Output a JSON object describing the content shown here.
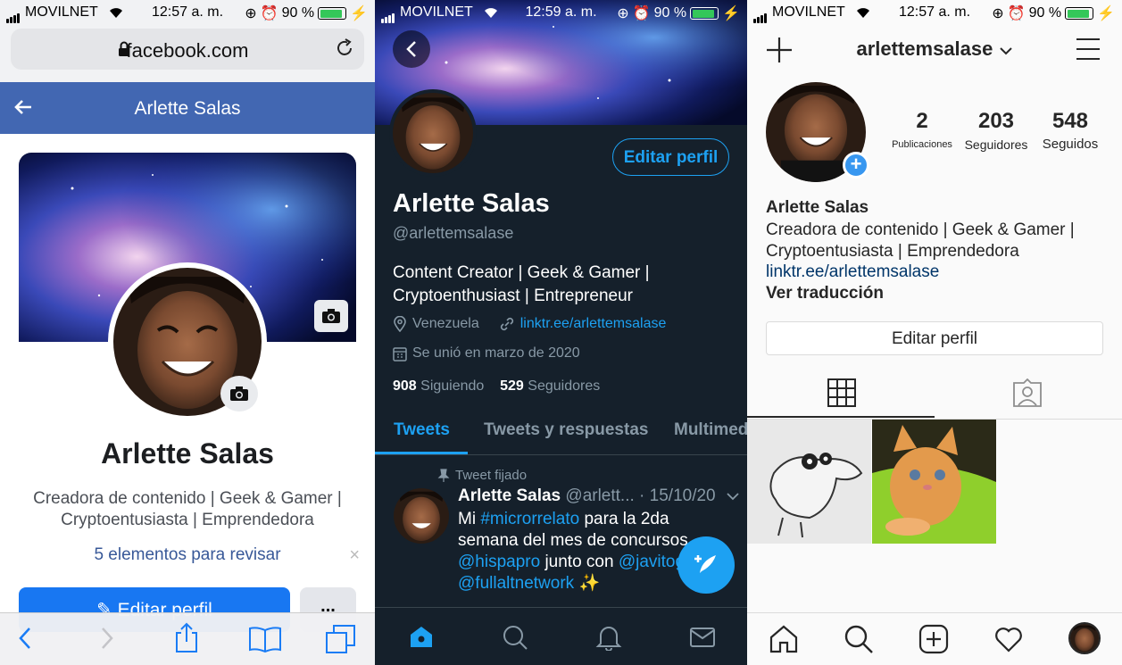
{
  "facebook": {
    "status": {
      "carrier": "MOVILNET",
      "time": "12:57 a. m.",
      "battery": "90 %",
      "battery_level": 0.9
    },
    "url": "facebook.com",
    "header_title": "Arlette Salas",
    "name": "Arlette Salas",
    "bio": "Creadora de contenido | Geek & Gamer | Cryptoentusiasta | Emprendedora",
    "review_link": "5 elementos para revisar",
    "close_glyph": "×",
    "edit_button": "Editar perfil",
    "more_button": "...",
    "icons": [
      "back-arrow-icon",
      "lock-icon",
      "reload-icon",
      "camera-icon",
      "nav-back-icon",
      "nav-forward-icon",
      "share-icon",
      "bookmarks-icon",
      "tabs-icon"
    ],
    "colors": {
      "brand": "#4267b2",
      "button": "#1877f2",
      "link": "#385898"
    }
  },
  "twitter": {
    "status": {
      "carrier": "MOVILNET",
      "time": "12:59 a. m.",
      "battery": "90 %",
      "battery_level": 0.9
    },
    "edit_button": "Editar perfil",
    "name": "Arlette Salas",
    "handle": "@arlettemsalase",
    "bio": "Content Creator | Geek & Gamer | Cryptoenthusiast | Entrepreneur",
    "location": "Venezuela",
    "link": "linktr.ee/arlettemsalase",
    "joined": "Se unió en marzo de 2020",
    "following_count": "908",
    "following_label": "Siguiendo",
    "followers_count": "529",
    "followers_label": "Seguidores",
    "tabs": [
      "Tweets",
      "Tweets y respuestas",
      "Multimed"
    ],
    "pinned_label": "Tweet fijado",
    "tweet": {
      "author": "Arlette Salas",
      "meta": "@arlett... · 15/10/20",
      "text_prefix": "Mi ",
      "hashtag": "#microrrelato",
      "text_mid": " para la 2da semana del mes de concursos ",
      "mention1": "@hispapro",
      "text_join": " junto con ",
      "mention2": "@javitog",
      "mention3": "@fullaltnetwork",
      "emoji": "✨"
    },
    "icons": [
      "back-icon",
      "location-icon",
      "link-icon",
      "calendar-icon",
      "pin-icon",
      "compose-icon",
      "home-icon",
      "search-icon",
      "bell-icon",
      "mail-icon"
    ],
    "colors": {
      "accent": "#1da1f2",
      "background": "#15202b"
    }
  },
  "instagram": {
    "status": {
      "carrier": "MOVILNET",
      "time": "12:57 a. m.",
      "battery": "90 %",
      "battery_level": 0.9
    },
    "username": "arlettemsalase",
    "posts_count": "2",
    "posts_label": "Publicaciones",
    "followers_count": "203",
    "followers_label": "Seguidores",
    "following_count": "548",
    "following_label": "Seguidos",
    "name": "Arlette Salas",
    "bio": "Creadora de contenido | Geek & Gamer | Cryptoentusiasta | Emprendedora",
    "link": "linktr.ee/arlettemsalase",
    "translate": "Ver traducción",
    "edit_button": "Editar perfil",
    "add_badge": "+",
    "icons": [
      "plus-icon",
      "chevron-down-icon",
      "menu-icon",
      "grid-icon",
      "tagged-icon",
      "home-icon",
      "search-icon",
      "add-post-icon",
      "heart-icon"
    ],
    "colors": {
      "link": "#003569",
      "badge": "#3897f0"
    }
  }
}
